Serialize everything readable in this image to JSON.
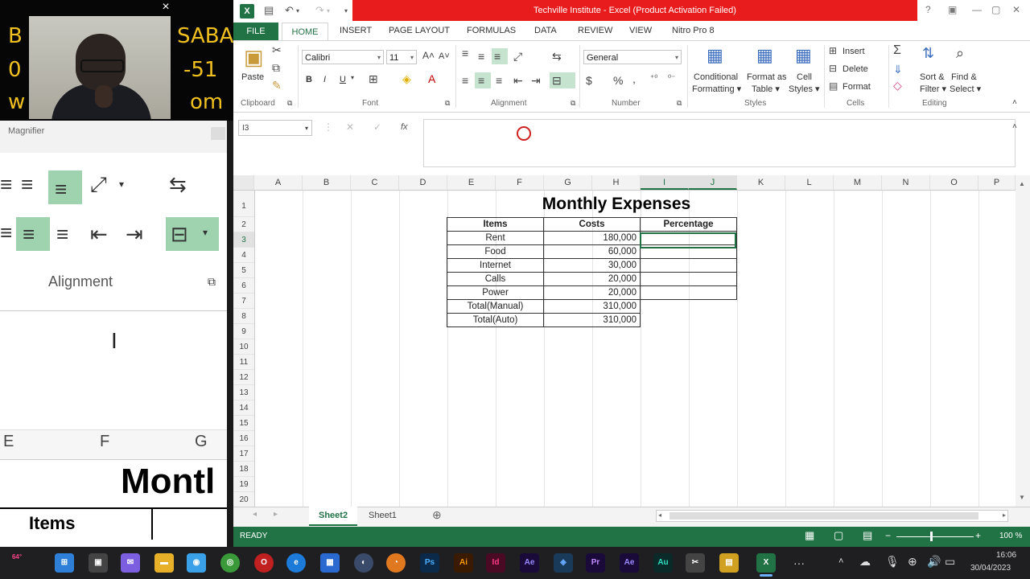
{
  "webcam": {
    "overlay_letters_left": [
      "B",
      "0",
      "w"
    ],
    "overlay_text_right": [
      "SABA",
      "-51",
      "om"
    ],
    "close_label": "×"
  },
  "magnifier": {
    "title": "Magnifier",
    "group_label": "Alignment",
    "col_headers": [
      "E",
      "F",
      "G"
    ],
    "big_text": "Montl",
    "items_label": "Items"
  },
  "window": {
    "title": "Techville Institute -  Excel (Product Activation Failed)",
    "help": "?",
    "controls": [
      "?",
      "▣",
      "—",
      "▢",
      "✕"
    ]
  },
  "ribbon": {
    "tabs": [
      "FILE",
      "HOME",
      "INSERT",
      "PAGE LAYOUT",
      "FORMULAS",
      "DATA",
      "REVIEW",
      "VIEW",
      "Nitro Pro 8"
    ],
    "clipboard": {
      "paste": "Paste",
      "label": "Clipboard"
    },
    "font": {
      "name": "Calibri",
      "size": "11",
      "label": "Font",
      "bold": "B",
      "italic": "I",
      "underline": "U"
    },
    "alignment": {
      "label": "Alignment"
    },
    "number": {
      "format": "General",
      "label": "Number",
      "currency": "$",
      "percent": "%",
      "comma": ","
    },
    "styles": {
      "conditional": [
        "Conditional",
        "Formatting ▾"
      ],
      "format_table": [
        "Format as",
        "Table ▾"
      ],
      "cell_styles": [
        "Cell",
        "Styles ▾"
      ],
      "label": "Styles"
    },
    "cells": {
      "insert": "Insert",
      "delete": "Delete",
      "format": "Format",
      "label": "Cells"
    },
    "editing": {
      "sort": [
        "Sort &",
        "Filter ▾"
      ],
      "find": [
        "Find &",
        "Select ▾"
      ],
      "label": "Editing"
    }
  },
  "formula_bar": {
    "name_box": "I3",
    "fx": "fx",
    "value": ""
  },
  "sheet": {
    "columns": [
      "A",
      "B",
      "C",
      "D",
      "E",
      "F",
      "G",
      "H",
      "I",
      "J",
      "K",
      "L",
      "M",
      "N",
      "O",
      "P"
    ],
    "selected_column": "I",
    "rows": [
      "1",
      "2",
      "3",
      "4",
      "5",
      "6",
      "7",
      "8",
      "9",
      "10",
      "11",
      "12",
      "13",
      "14",
      "15",
      "16",
      "17",
      "18",
      "19",
      "20"
    ],
    "selected_row": "3",
    "title": "Monthly Expenses",
    "table": {
      "headers": [
        "Items",
        "Costs",
        "Percentage"
      ],
      "rows": [
        {
          "item": "Rent",
          "cost": "180,000",
          "pct": ""
        },
        {
          "item": "Food",
          "cost": "60,000",
          "pct": ""
        },
        {
          "item": "Internet",
          "cost": "30,000",
          "pct": ""
        },
        {
          "item": "Calls",
          "cost": "20,000",
          "pct": ""
        },
        {
          "item": "Power",
          "cost": "20,000",
          "pct": ""
        }
      ],
      "totals": [
        {
          "item": "Total(Manual)",
          "cost": "310,000"
        },
        {
          "item": "Total(Auto)",
          "cost": "310,000"
        }
      ]
    }
  },
  "sheet_tabs": [
    "Sheet2",
    "Sheet1"
  ],
  "active_sheet": "Sheet2",
  "status": {
    "text": "READY",
    "zoom": "100 %"
  },
  "taskbar": {
    "apps": [
      "Ps",
      "Ai",
      "Id",
      "Ae",
      "Pr",
      "Ae",
      "Au"
    ],
    "time": "16:06",
    "date": "30/04/2023",
    "more": "···"
  }
}
